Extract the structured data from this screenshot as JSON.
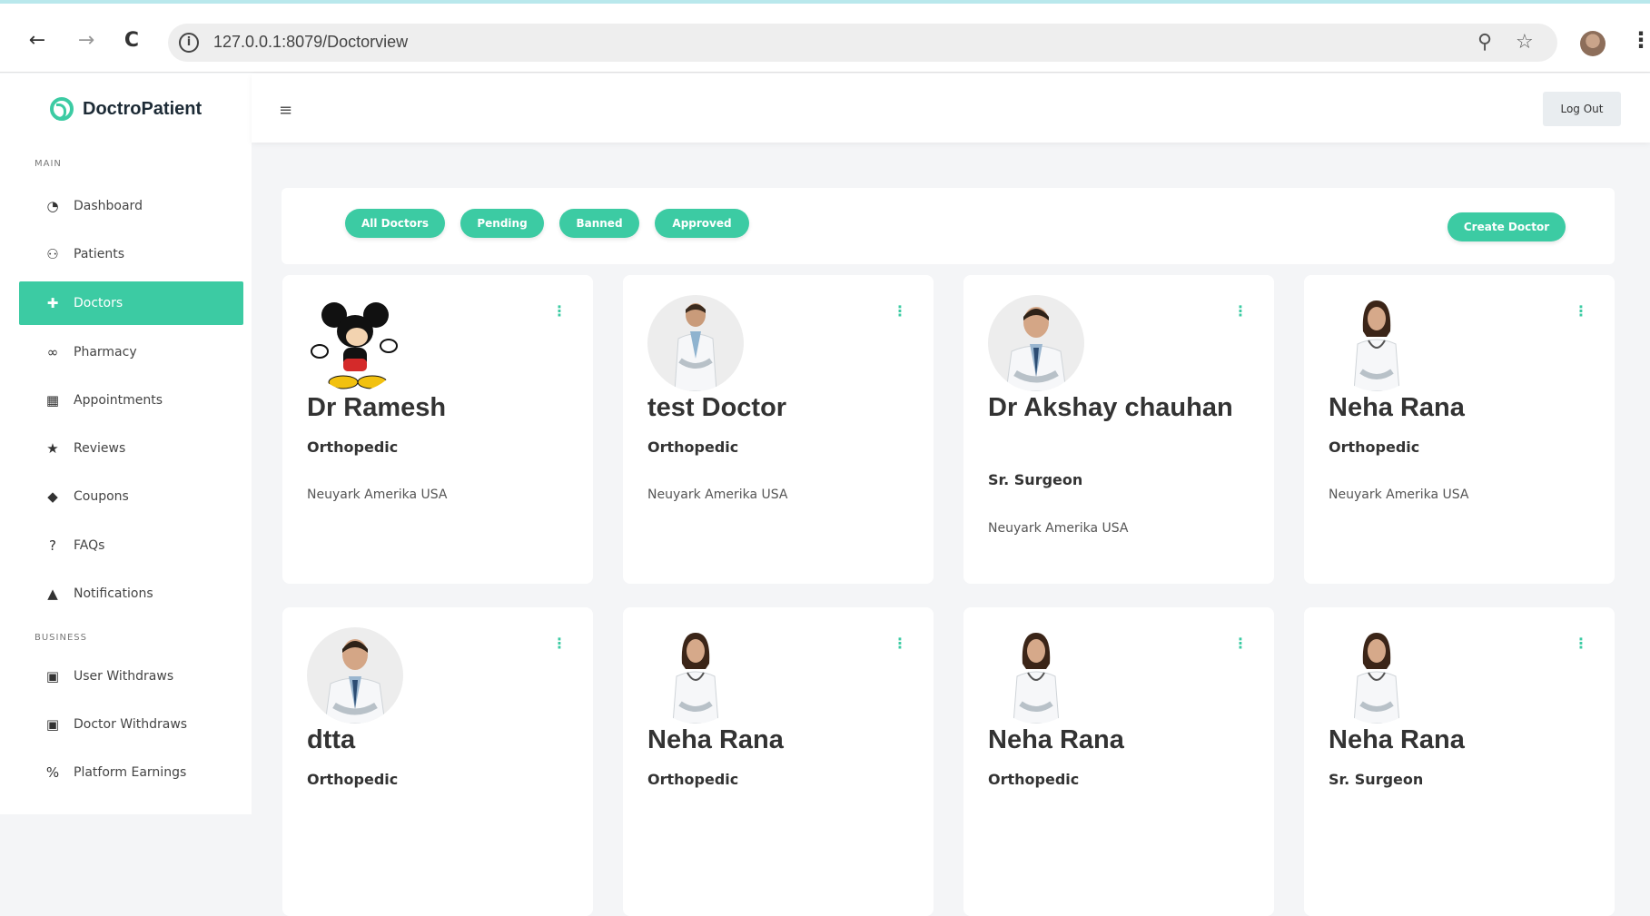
{
  "browser": {
    "url": "127.0.0.1:8079/Doctorview",
    "back_glyph": "←",
    "forward_glyph": "→",
    "reload_glyph": "C",
    "info_glyph": "i",
    "zoom_glyph": "⚲",
    "star_glyph": "☆",
    "menu_glyph": "⋮"
  },
  "brand": {
    "name": "DoctroPatient",
    "color": "#3ccba3"
  },
  "sidebar": {
    "main_label": "MAIN",
    "business_label": "BUSINESS",
    "items": [
      {
        "label": "Dashboard",
        "icon": "dashboard-icon",
        "glyph": "◔"
      },
      {
        "label": "Patients",
        "icon": "users-icon",
        "glyph": "⚇"
      },
      {
        "label": "Doctors",
        "icon": "plus-square-icon",
        "glyph": "✚"
      },
      {
        "label": "Pharmacy",
        "icon": "binoculars-icon",
        "glyph": "∞"
      },
      {
        "label": "Appointments",
        "icon": "calendar-icon",
        "glyph": "▦"
      },
      {
        "label": "Reviews",
        "icon": "star-icon",
        "glyph": "★"
      },
      {
        "label": "Coupons",
        "icon": "tag-icon",
        "glyph": "◆"
      },
      {
        "label": "FAQs",
        "icon": "question-icon",
        "glyph": "?"
      },
      {
        "label": "Notifications",
        "icon": "bell-icon",
        "glyph": "▲"
      },
      {
        "label": "User Withdraws",
        "icon": "money-icon",
        "glyph": "▣"
      },
      {
        "label": "Doctor Withdraws",
        "icon": "money-icon",
        "glyph": "▣"
      },
      {
        "label": "Platform Earnings",
        "icon": "percent-icon",
        "glyph": "%"
      }
    ],
    "active_index": 2
  },
  "header": {
    "menu_glyph": "≡",
    "logout_label": "Log Out"
  },
  "filters": {
    "tabs": [
      "All Doctors",
      "Pending",
      "Banned",
      "Approved"
    ],
    "create_label": "Create Doctor"
  },
  "doctors": [
    {
      "name": "Dr Ramesh",
      "specialty": "Orthopedic",
      "location": "Neuyark Amerika USA",
      "avatar": "cartoon-mouse"
    },
    {
      "name": "test Doctor",
      "specialty": "Orthopedic",
      "location": "Neuyark Amerika USA",
      "avatar": "male-doctor"
    },
    {
      "name": "Dr Akshay chauhan",
      "specialty": "Sr. Surgeon",
      "location": "Neuyark Amerika USA",
      "avatar": "male-doctor"
    },
    {
      "name": "Neha Rana",
      "specialty": "Orthopedic",
      "location": "Neuyark Amerika USA",
      "avatar": "female-doctor"
    },
    {
      "name": "dtta",
      "specialty": "Orthopedic",
      "location": "",
      "avatar": "male-doctor"
    },
    {
      "name": "Neha Rana",
      "specialty": "Orthopedic",
      "location": "",
      "avatar": "female-doctor"
    },
    {
      "name": "Neha Rana",
      "specialty": "Orthopedic",
      "location": "",
      "avatar": "female-doctor"
    },
    {
      "name": "Neha Rana",
      "specialty": "Sr. Surgeon",
      "location": "",
      "avatar": "female-doctor"
    }
  ],
  "card_menu_glyph": "⋮"
}
